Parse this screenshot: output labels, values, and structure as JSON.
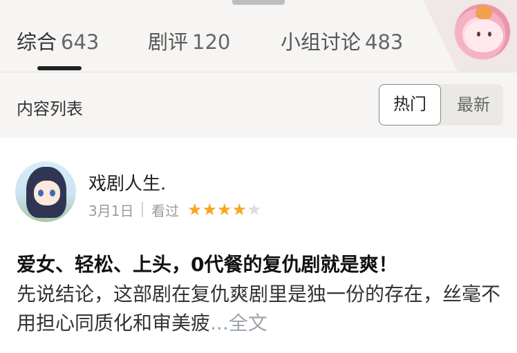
{
  "tabs": [
    {
      "label": "综合",
      "count": "643",
      "active": true
    },
    {
      "label": "剧评",
      "count": "120",
      "active": false
    },
    {
      "label": "小组讨论",
      "count": "483",
      "active": false
    }
  ],
  "section": {
    "title": "内容列表",
    "sort_options": [
      "热门",
      "最新"
    ],
    "sort_selected": "热门"
  },
  "review": {
    "user_name": "戏剧人生.",
    "date": "3月1日",
    "status": "看过",
    "rating": 4,
    "rating_max": 5,
    "title": "爱女、轻松、上头，0代餐的复仇剧就是爽！",
    "body": "先说结论，这部剧在复仇爽剧里是独一份的存在，丝毫不用担心同质化和审美疲",
    "ellipsis": "...",
    "more_label": "全文"
  },
  "colors": {
    "star_filled": "#f5a623",
    "star_empty": "#dddddd",
    "top_background": "#f6f5f3",
    "tab_indicator": "#222222"
  }
}
